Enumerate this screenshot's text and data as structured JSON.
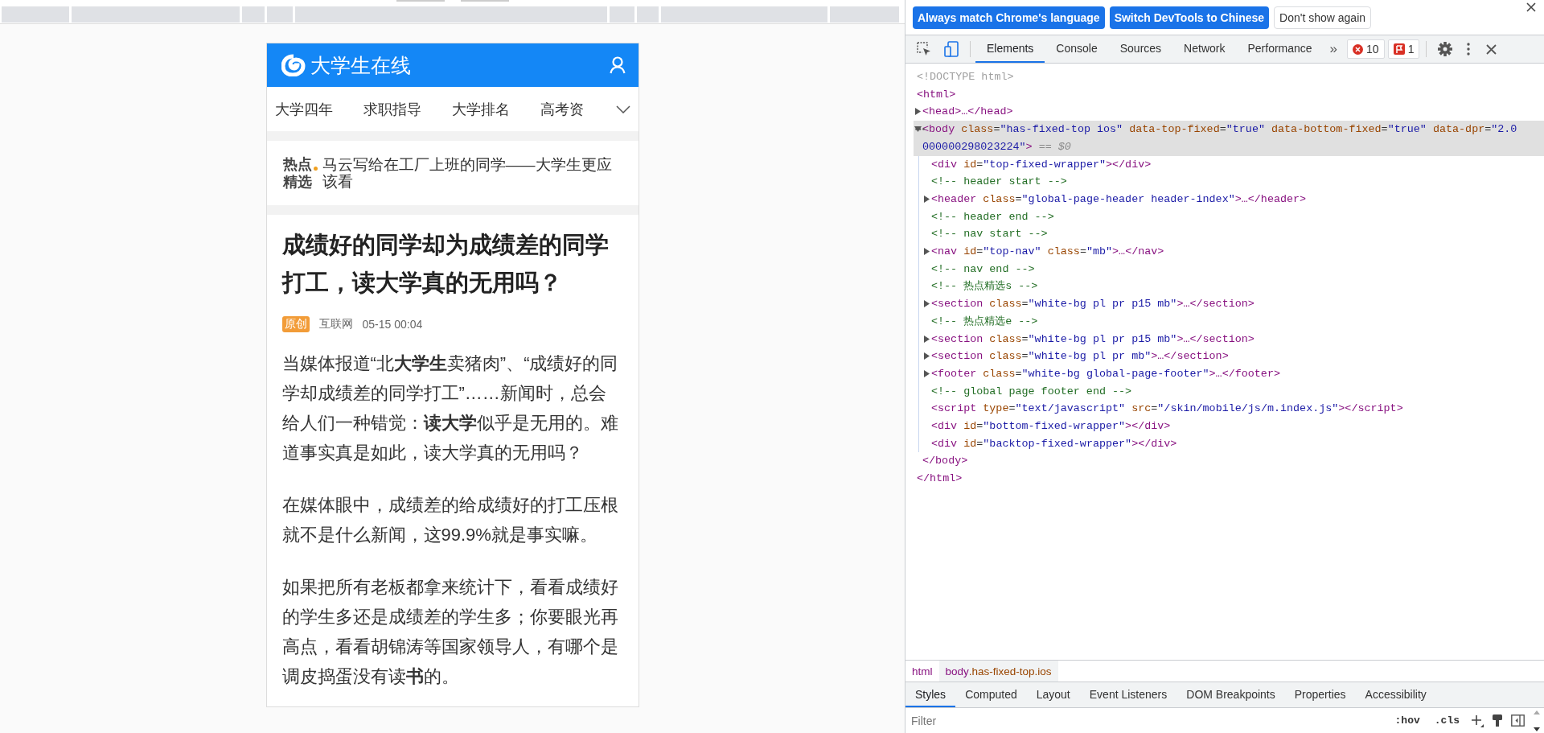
{
  "page": {
    "header": {
      "site_name": "大学生在线"
    },
    "nav": {
      "items": [
        "大学四年",
        "求职指导",
        "大学排名",
        "高考资"
      ]
    },
    "hot": {
      "label": "热点精选",
      "headline": "马云写给在工厂上班的同学——大学生更应该看"
    },
    "article": {
      "title": "成绩好的同学却为成绩差的同学打工，读大学真的无用吗？",
      "badge": "原创",
      "source": "互联网",
      "time": "05-15 00:04",
      "paragraphs": [
        "当媒体报道“北**大学生**卖猪肉”、“成绩好的同学却成绩差的同学打工”……新闻时，总会给人们一种错觉：**读大学**似乎是无用的。难道事实真是如此，读大学真的无用吗？",
        "在媒体眼中，成绩差的给成绩好的打工压根就不是什么新闻，这99.9%就是事实嘛。",
        "如果把所有老板都拿来统计下，看看成绩好的学生多还是成绩差的学生多；你要眼光再高点，看看胡锦涛等国家领导人，有哪个是调皮捣蛋没有读**书**的。"
      ]
    }
  },
  "devtools": {
    "infobar": {
      "buttons": [
        {
          "label": "Always match Chrome's language",
          "kind": "primary"
        },
        {
          "label": "Switch DevTools to Chinese",
          "kind": "primary"
        },
        {
          "label": "Don't show again",
          "kind": "secondary"
        }
      ]
    },
    "tabs": [
      {
        "label": "Elements",
        "selected": true
      },
      {
        "label": "Console",
        "selected": false
      },
      {
        "label": "Sources",
        "selected": false
      },
      {
        "label": "Network",
        "selected": false
      },
      {
        "label": "Performance",
        "selected": false
      }
    ],
    "more_tabs": "»",
    "error_count": "10",
    "issue_count": "1",
    "dom_tree": [
      {
        "kind": "doctype",
        "text": "<!DOCTYPE html>",
        "selected": false
      },
      {
        "kind": "element",
        "text": "<html>",
        "selected": false,
        "closing": "</html>",
        "children": [
          {
            "kind": "parent",
            "text": "<head>…</head>",
            "expanded": false,
            "selected": false
          },
          {
            "kind": "parent",
            "text": "<body class=\"has-fixed-top ios\" data-top-fixed=\"true\" data-bottom-fixed=\"true\" data-dpr=\"2.0000000298023224\">",
            "expanded": true,
            "selected": true,
            "console_ref": "== $0",
            "closing": "</body>",
            "children": [
              {
                "kind": "element",
                "text": "<div id=\"top-fixed-wrapper\"></div>",
                "selected": false
              },
              {
                "kind": "comment",
                "text": "<!-- header start -->",
                "selected": false
              },
              {
                "kind": "parent",
                "text": "<header class=\"global-page-header header-index\">…</header>",
                "expanded": false,
                "selected": false
              },
              {
                "kind": "comment",
                "text": "<!-- header end -->",
                "selected": false
              },
              {
                "kind": "comment",
                "text": "<!-- nav start -->",
                "selected": false
              },
              {
                "kind": "parent",
                "text": "<nav id=\"top-nav\" class=\"mb\">…</nav>",
                "expanded": false,
                "selected": false
              },
              {
                "kind": "comment",
                "text": "<!-- nav end -->",
                "selected": false
              },
              {
                "kind": "comment",
                "text": "<!-- 热点精选s -->",
                "selected": false
              },
              {
                "kind": "parent",
                "text": "<section class=\"white-bg pl pr p15 mb\">…</section>",
                "expanded": false,
                "selected": false
              },
              {
                "kind": "comment",
                "text": "<!-- 热点精选e -->",
                "selected": false
              },
              {
                "kind": "parent",
                "text": "<section class=\"white-bg pl pr p15 mb\">…</section>",
                "expanded": false,
                "selected": false
              },
              {
                "kind": "parent",
                "text": "<section class=\"white-bg pl pr mb\">…</section>",
                "expanded": false,
                "selected": false
              },
              {
                "kind": "parent",
                "text": "<footer class=\"white-bg global-page-footer\">…</footer>",
                "expanded": false,
                "selected": false
              },
              {
                "kind": "comment",
                "text": "<!-- global page footer end -->",
                "selected": false
              },
              {
                "kind": "element",
                "text": "<script type=\"text/javascript\" src=\"/skin/mobile/js/m.index.js\"></script>",
                "selected": false
              },
              {
                "kind": "element",
                "text": "<div id=\"bottom-fixed-wrapper\"></div>",
                "selected": false
              },
              {
                "kind": "element",
                "text": "<div id=\"backtop-fixed-wrapper\"></div>",
                "selected": false
              }
            ]
          }
        ]
      }
    ],
    "breadcrumbs": [
      {
        "label": "html",
        "selected": false
      },
      {
        "label": "body.has-fixed-top.ios",
        "selected": true
      }
    ],
    "sidebar_tabs": [
      {
        "label": "Styles",
        "selected": true
      },
      {
        "label": "Computed",
        "selected": false
      },
      {
        "label": "Layout",
        "selected": false
      },
      {
        "label": "Event Listeners",
        "selected": false
      },
      {
        "label": "DOM Breakpoints",
        "selected": false
      },
      {
        "label": "Properties",
        "selected": false
      },
      {
        "label": "Accessibility",
        "selected": false
      }
    ],
    "filter": {
      "placeholder": "Filter"
    },
    "filter_buttons": [
      ":hov",
      ".cls"
    ]
  }
}
